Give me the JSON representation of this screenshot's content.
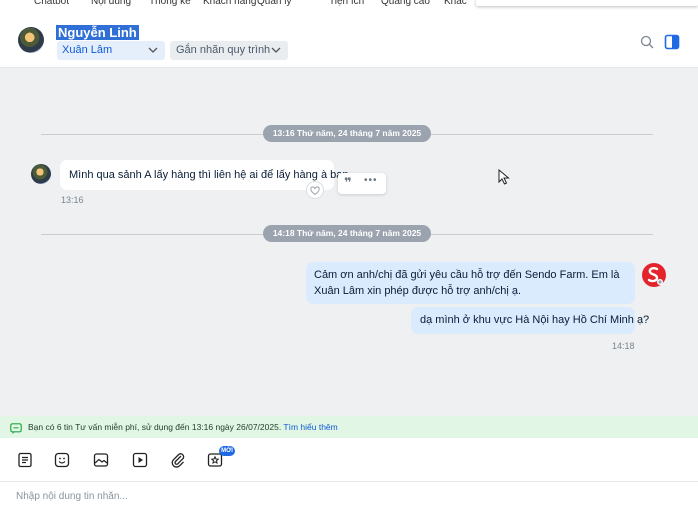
{
  "topnav": {
    "items": [
      "Chatbot",
      "Nội dung",
      "Thống kê",
      "Khách hàng",
      "Quản lý",
      "Tiện ích",
      "Quảng cáo",
      "Khác"
    ]
  },
  "header": {
    "contact_name": "Nguyễn Linh",
    "assignee": "Xuân Lâm",
    "tag_button": "Gắn nhãn quy trình"
  },
  "chat": {
    "date_separator_1": "13:16 Thứ năm, 24 tháng 7 năm 2025",
    "incoming_message": "Mình qua sảnh A lấy hàng thì liên hệ ai để lấy hàng à bạn",
    "incoming_time": "13:16",
    "date_separator_2": "14:18 Thứ năm, 24 tháng 7 năm 2025",
    "outgoing_message_1": "Cảm ơn anh/chị đã gửi yêu cầu hỗ trợ đến Sendo Farm. Em là Xuân Lâm xin phép được hỗ trợ anh/chị ạ.",
    "outgoing_message_2": "dạ mình ở khu vực Hà Nội hay Hồ Chí Minh ạ?",
    "outgoing_time": "14:18"
  },
  "notice": {
    "text": "Bạn có 6 tin Tư vấn miễn phí, sử dụng đến 13:16 ngày 26/07/2025.",
    "link": "Tìm hiểu thêm"
  },
  "toolbar": {
    "new_badge": "MỚI"
  },
  "composer": {
    "placeholder": "Nhập nội dung tin nhắn..."
  },
  "colors": {
    "accent": "#0d5bd7",
    "outgoing_bubble": "#dbebfe",
    "chat_bg": "#eef0f1",
    "notice_bg": "#e1f6e4"
  }
}
